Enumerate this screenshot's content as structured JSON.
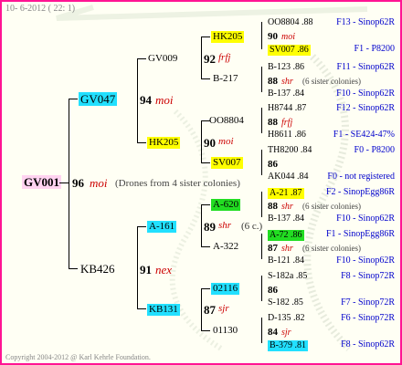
{
  "header": {
    "date": "10-  6-2012 ( 22:  1)"
  },
  "footer": {
    "copyright": "Copyright 2004-2012 @ Karl Kehrle Foundation."
  },
  "root": {
    "id": "GV001",
    "num": "96",
    "race": "moi",
    "note": "(Drones from 4 sister colonies)"
  },
  "gen1": [
    {
      "id": "GV047",
      "num": "94",
      "race": "moi"
    },
    {
      "id": "KB426",
      "num": "91",
      "race": "nex"
    }
  ],
  "gen2": [
    {
      "id": "GV009",
      "num": "92",
      "race": "frfj"
    },
    {
      "id": "HK205",
      "num": "90",
      "race": "moi"
    },
    {
      "id": "A-161",
      "num": "89",
      "race": "shr",
      "note": "(6 c.)"
    },
    {
      "id": "KB131",
      "num": "87",
      "race": "sjr"
    }
  ],
  "gen3": [
    {
      "id": "HK205",
      "num": "88",
      "race": "shr",
      "note": "(6 sister colonies)"
    },
    {
      "id": "B-217",
      "num": ""
    },
    {
      "id": "OO8804",
      "num": ""
    },
    {
      "id": "SV007",
      "num": ""
    },
    {
      "id": "A-620",
      "num": "88",
      "race": "shr",
      "note": "(6 sister colonies)"
    },
    {
      "id": "A-322",
      "num": "87",
      "race": "shr",
      "note": "(6 sister colonies)"
    },
    {
      "id": "02116",
      "num": ""
    },
    {
      "id": "01130",
      "num": ""
    }
  ],
  "gen4": [
    {
      "text": "OO8804 .88",
      "info": "F13 - Sinop62R"
    },
    {
      "num": "90",
      "race": "moi"
    },
    {
      "text": "SV007 .86",
      "info": "F1 - P8200"
    },
    {
      "text": "B-123 .86",
      "info": "F11 - Sinop62R"
    },
    {
      "num": "88",
      "race": "shr",
      "note": "(6 sister colonies)"
    },
    {
      "text": "B-137 .84",
      "info": "F10 - Sinop62R"
    },
    {
      "text": "H8744 .87",
      "info": "F12 - Sinop62R"
    },
    {
      "num": "88",
      "race": "frfj"
    },
    {
      "text": "H8611 .86",
      "info": "F1 - SE424-47%"
    },
    {
      "text": "TH8200 .84",
      "info": "F0 - P8200"
    },
    {
      "num": "86"
    },
    {
      "text": "AK044 .84",
      "info": "F0 - not registered"
    },
    {
      "text": "A-21 .87",
      "info": "F2 - SinopEgg86R"
    },
    {
      "num": "88",
      "race": "shr",
      "note": "(6 sister colonies)"
    },
    {
      "text": "B-137 .84",
      "info": "F10 - Sinop62R"
    },
    {
      "text": "A-72 .86",
      "info": "F1 - SinopEgg86R"
    },
    {
      "num": "87",
      "race": "shr",
      "note": "(6 sister colonies)"
    },
    {
      "text": "B-121 .84",
      "info": "F10 - Sinop62R"
    },
    {
      "text": "S-182a .85",
      "info": "F8 - Sinop72R"
    },
    {
      "num": "86"
    },
    {
      "text": "S-182 .85",
      "info": "F7 - Sinop72R"
    },
    {
      "text": "D-135 .82",
      "info": "F6 - Sinop72R"
    },
    {
      "num": "84",
      "race": "sjr"
    },
    {
      "text": "B-379 .81",
      "info": "F8 - Sinop62R"
    }
  ],
  "colors": {
    "frame": "#ff1493",
    "cyan": "#22e0ff",
    "yellow": "#ffff00",
    "green": "#22dd22",
    "pink": "#ffd3f0",
    "info": "#0000cc",
    "race": "#cc0000"
  }
}
